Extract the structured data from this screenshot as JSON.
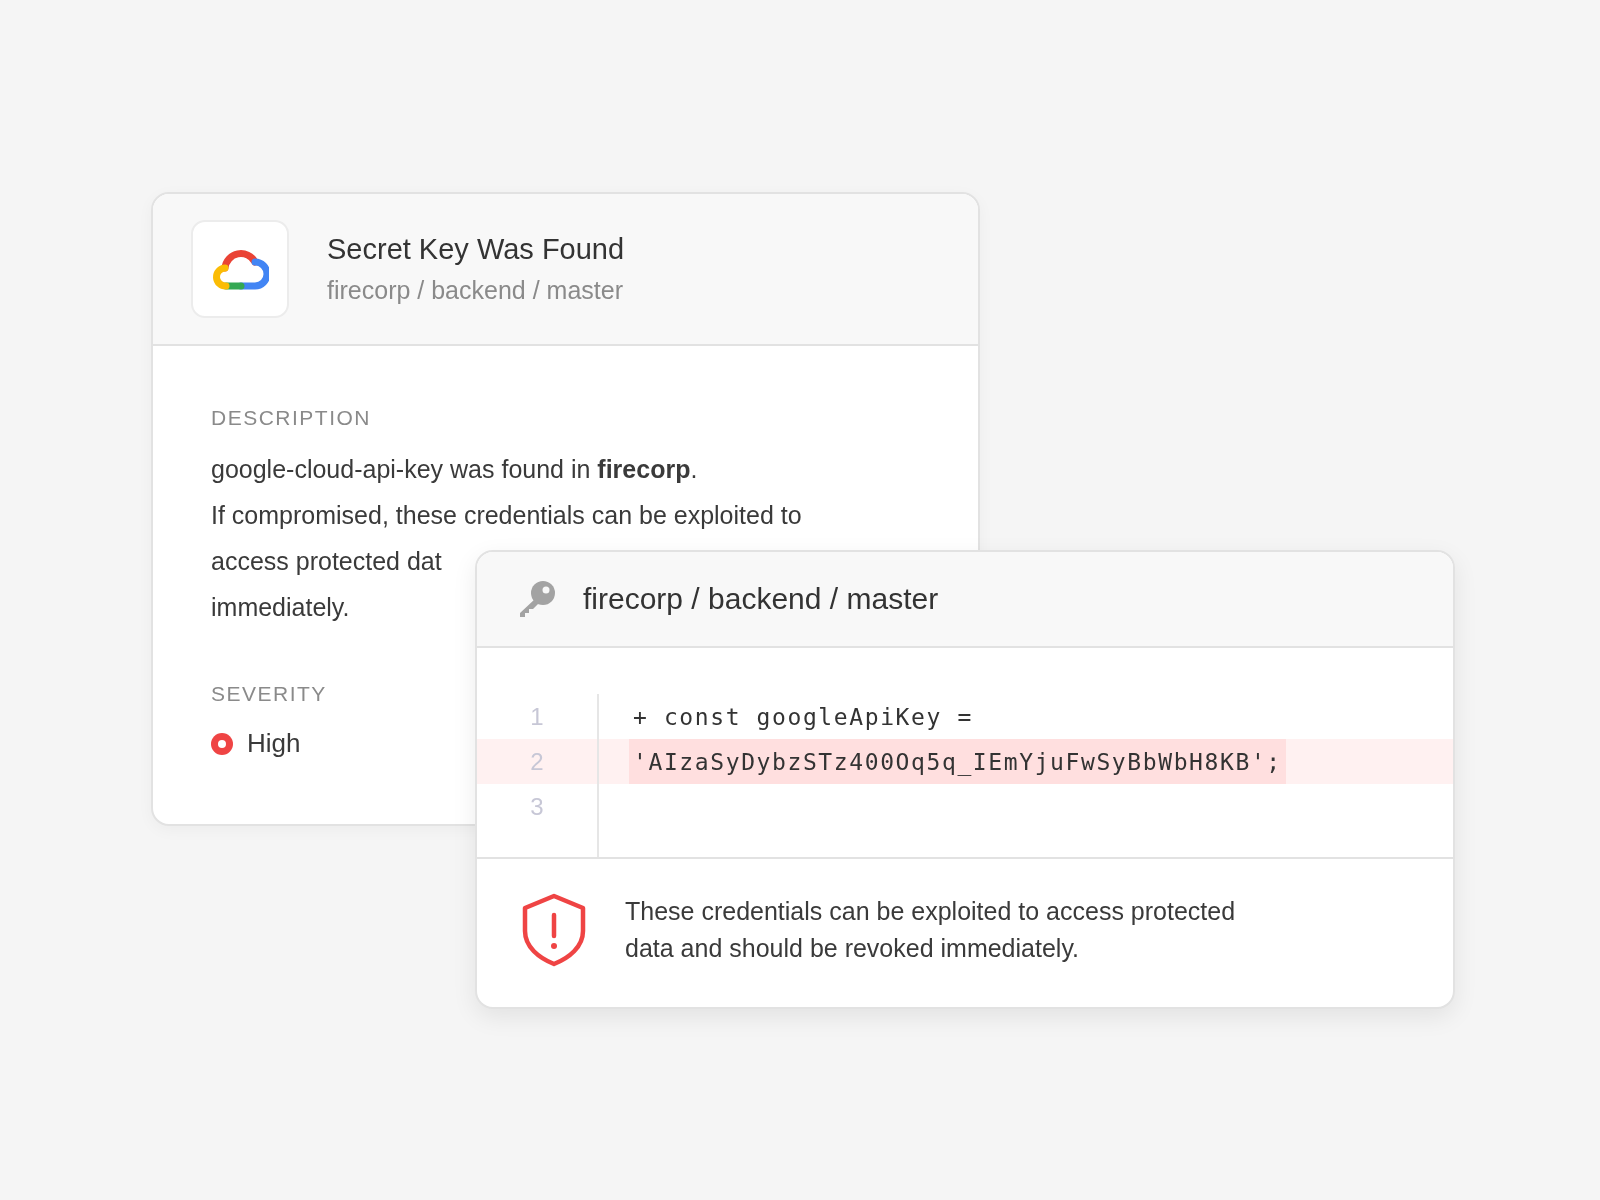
{
  "finding_card": {
    "title": "Secret Key Was Found",
    "subtitle": "firecorp / backend / master",
    "description_label": "DESCRIPTION",
    "description_lines": [
      "google-cloud-api-key was found in **firecorp**.",
      "If compromised, these credentials can be exploited to",
      "access protected dat",
      "immediately."
    ],
    "severity_label": "SEVERITY",
    "severity": {
      "label": "High",
      "color": "#ef4444"
    }
  },
  "code_card": {
    "title": "firecorp / backend / master",
    "lines": [
      {
        "number": "1",
        "code": "+ const googleApiKey =",
        "highlighted": false
      },
      {
        "number": "2",
        "code": "'AIzaSyDybzSTz400Oq5q_IEmYjuFwSyBbWbH8KB';",
        "highlighted": true
      },
      {
        "number": "3",
        "highlighted": false
      }
    ],
    "warning": "These credentials can be exploited to access protected data and should be revoked immediately."
  }
}
